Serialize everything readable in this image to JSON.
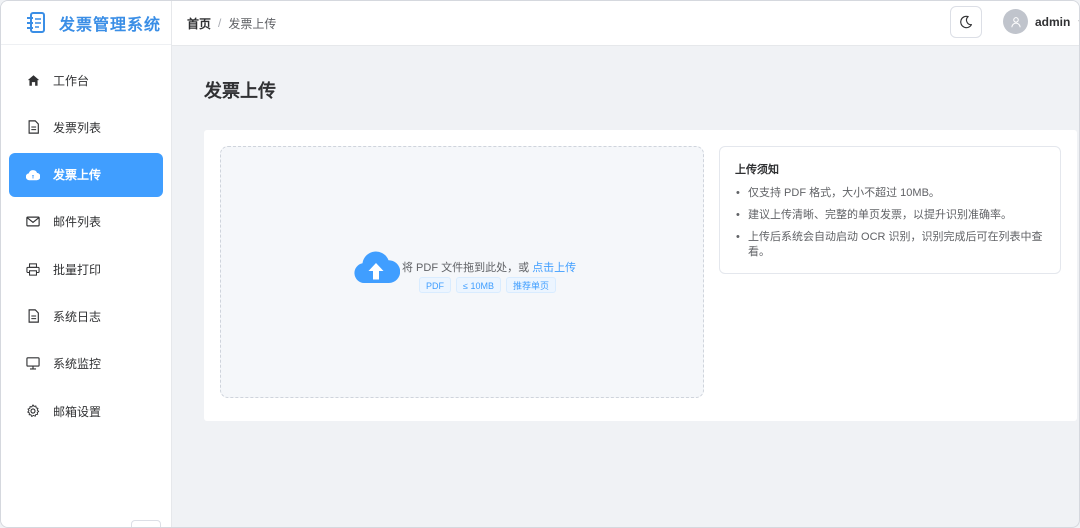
{
  "app": {
    "title": "发票管理系统"
  },
  "sidebar": {
    "items": [
      {
        "label": "工作台",
        "icon": "home-icon"
      },
      {
        "label": "发票列表",
        "icon": "document-icon"
      },
      {
        "label": "发票上传",
        "icon": "cloud-upload-icon",
        "active": true
      },
      {
        "label": "邮件列表",
        "icon": "mail-icon"
      },
      {
        "label": "批量打印",
        "icon": "printer-icon"
      },
      {
        "label": "系统日志",
        "icon": "document-icon"
      },
      {
        "label": "系统监控",
        "icon": "monitor-icon"
      },
      {
        "label": "邮箱设置",
        "icon": "gear-icon"
      }
    ]
  },
  "header": {
    "breadcrumb": {
      "home": "首页",
      "separator": "/",
      "current": "发票上传"
    },
    "theme_icon": "moon-icon",
    "user": {
      "name": "admin"
    }
  },
  "main": {
    "title": "发票上传",
    "upload": {
      "hint": "将 PDF 文件拖到此处，或",
      "link": "点击上传",
      "tags": [
        "PDF",
        "≤ 10MB",
        "推荐单页"
      ]
    },
    "notice": {
      "title": "上传须知",
      "items": [
        "仅支持 PDF 格式，大小不超过 10MB。",
        "建议上传清晰、完整的单页发票，以提升识别准确率。",
        "上传后系统会自动启动 OCR 识别，识别完成后可在列表中查看。"
      ]
    }
  },
  "colors": {
    "accent": "#409eff",
    "brand_text": "#3a8ee6"
  }
}
